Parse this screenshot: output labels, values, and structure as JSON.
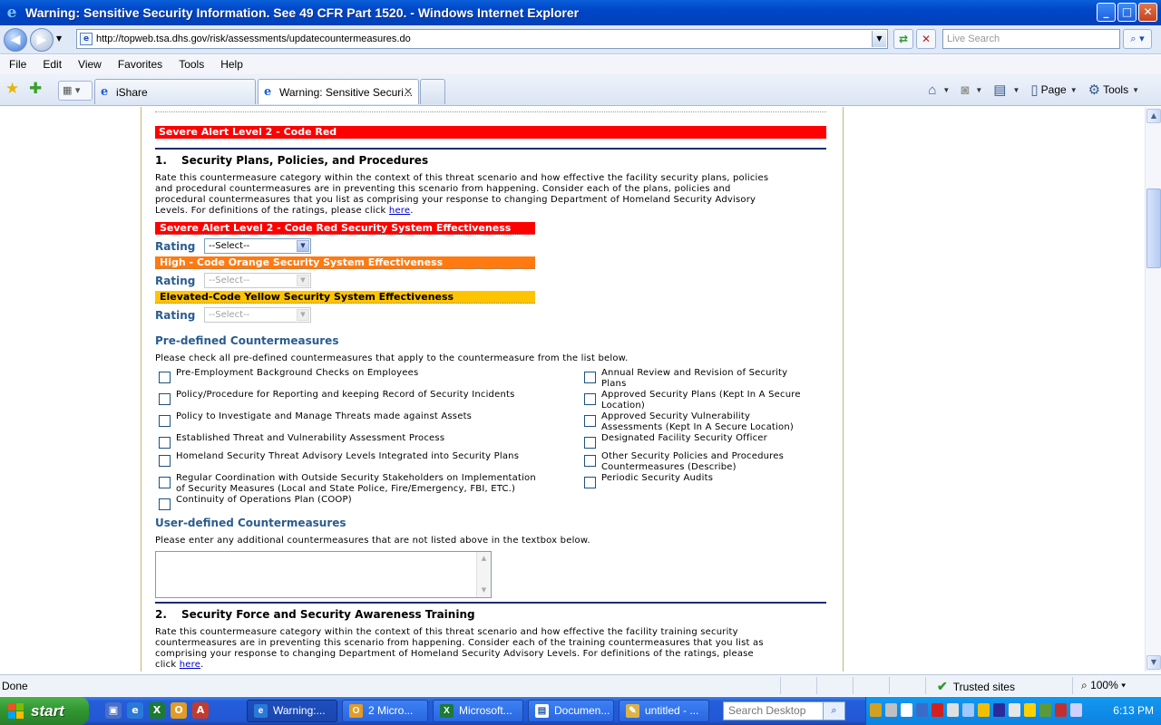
{
  "window": {
    "title": "Warning: Sensitive Security Information. See 49 CFR Part 1520. - Windows Internet Explorer",
    "minimize": "_",
    "maximize": "□",
    "close": "✕"
  },
  "address": {
    "url": "http://topweb.tsa.dhs.gov/risk/assessments/updatecountermeasures.do",
    "search_placeholder": "Live Search"
  },
  "menu": [
    "File",
    "Edit",
    "View",
    "Favorites",
    "Tools",
    "Help"
  ],
  "tabs": [
    {
      "label": "iShare",
      "active": false
    },
    {
      "label": "Warning: Sensitive Securi...",
      "active": true
    }
  ],
  "command_bar": {
    "page_label": "Page",
    "tools_label": "Tools"
  },
  "page": {
    "top_banner": "Severe Alert Level 2 - Code Red",
    "section1": {
      "number": "1.",
      "title": "Security Plans, Policies, and Procedures",
      "paragraph_l1": "Rate this countermeasure category within the context of this threat scenario and how effective the facility security plans, policies",
      "paragraph_l2": "and procedural countermeasures are in preventing this scenario from happening. Consider each of the plans, policies and",
      "paragraph_l3": "procedural countermeasures that you list as comprising your response to changing Department of Homeland Security Advisory",
      "paragraph_l4": "Levels. For definitions of the ratings, please click",
      "link": "here",
      "levels": [
        {
          "label": "Severe Alert Level 2 - Code Red Security System Effectiveness",
          "color": "#ff0000"
        },
        {
          "label": "High - Code Orange Security System Effectiveness",
          "color": "#ff7a10"
        },
        {
          "label": "Elevated-Code Yellow Security System Effectiveness",
          "color": "#ffc400"
        }
      ],
      "rating_label": "Rating",
      "select_value": "--Select--",
      "predefined_heading": "Pre-defined Countermeasures",
      "predefined_instructions": "Please check all pre-defined countermeasures that apply to the countermeasure from the list below.",
      "left_items": [
        {
          "l1": "Pre-Employment Background Checks on Employees",
          "l2": ""
        },
        {
          "l1": "Policy/Procedure for Reporting and keeping Record of Security Incidents",
          "l2": ""
        },
        {
          "l1": "Policy to Investigate and Manage Threats made against Assets",
          "l2": ""
        },
        {
          "l1": "Established Threat and Vulnerability Assessment Process",
          "l2": ""
        },
        {
          "l1": "Homeland Security Threat Advisory Levels Integrated into Security Plans",
          "l2": ""
        },
        {
          "l1": "Regular Coordination with Outside Security Stakeholders on Implementation",
          "l2": "of Security Measures (Local and State Police, Fire/Emergency, FBI, ETC.)"
        },
        {
          "l1": "Continuity of Operations Plan (COOP)",
          "l2": ""
        }
      ],
      "right_items": [
        {
          "l1": "Annual Review and Revision of Security",
          "l2": "Plans"
        },
        {
          "l1": "Approved Security Plans (Kept In A Secure",
          "l2": "Location)"
        },
        {
          "l1": "Approved Security Vulnerability",
          "l2": "Assessments (Kept In A Secure Location)"
        },
        {
          "l1": "Designated Facility Security Officer",
          "l2": ""
        },
        {
          "l1": "Other Security Policies and Procedures",
          "l2": "Countermeasures (Describe)"
        },
        {
          "l1": "Periodic Security Audits",
          "l2": ""
        }
      ],
      "userdefined_heading": "User-defined Countermeasures",
      "userdefined_instructions": "Please enter any additional countermeasures that are not listed above in the textbox below."
    },
    "section2": {
      "number": "2.",
      "title": "Security Force and Security Awareness Training",
      "paragraph_l1": "Rate this countermeasure category within the context of this threat scenario and how effective the facility training security",
      "paragraph_l2": "countermeasures are in preventing this scenario from happening. Consider each of the training countermeasures that you list as",
      "paragraph_l3": "comprising your response to changing Department of Homeland Security Advisory Levels. For definitions of the ratings, please",
      "paragraph_l4": "click",
      "link": "here"
    }
  },
  "status": {
    "text": "Done",
    "zone": "Trusted sites",
    "zoom": "100%"
  },
  "taskbar": {
    "start": "start",
    "tasks": [
      {
        "label": "Warning:...",
        "active": true
      },
      {
        "label": "2 Micro...",
        "active": false
      },
      {
        "label": "Microsoft...",
        "active": false
      },
      {
        "label": "Documen...",
        "active": false
      },
      {
        "label": "untitled - ...",
        "active": false
      }
    ],
    "search_placeholder": "Search Desktop",
    "clock": "6:13 PM"
  }
}
